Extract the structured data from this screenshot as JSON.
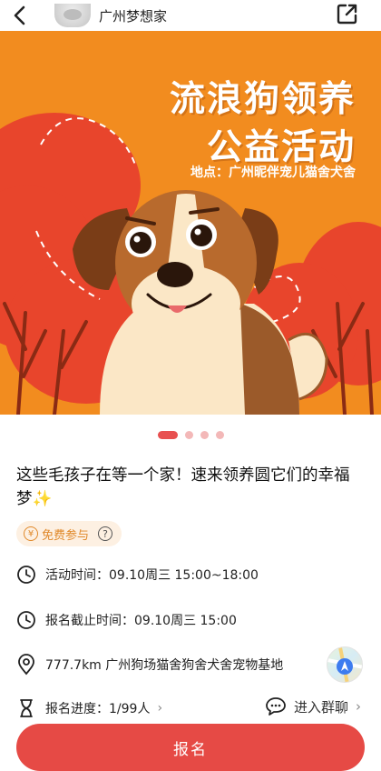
{
  "header": {
    "org_name": "广州梦想家",
    "back_icon": "chevron-left-icon",
    "share_icon": "share-export-icon"
  },
  "banner": {
    "title_line1": "流浪狗领养",
    "title_line2": "公益活动",
    "location": "地点：广州昵伴宠儿猫舍犬舍",
    "slide_count": 4,
    "active_slide": 1,
    "colors": {
      "background": "#f28c1f",
      "trees": "#e8452c",
      "accent": "#e85050"
    }
  },
  "event": {
    "title": "这些毛孩子在等一个家！速来领养圆它们的幸福梦✨",
    "tag_label": "免费参与",
    "tag_yen": "¥",
    "tag_help": "?",
    "time": "活动时间：09.10周三 15:00~18:00",
    "deadline": "报名截止时间：09.10周三 15:00",
    "location": "777.7km 广州狗场猫舍狗舍犬舍宠物基地",
    "progress": "报名进度：1/99人",
    "group_chat": "进入群聊"
  },
  "actions": {
    "signup_label": "报名"
  }
}
